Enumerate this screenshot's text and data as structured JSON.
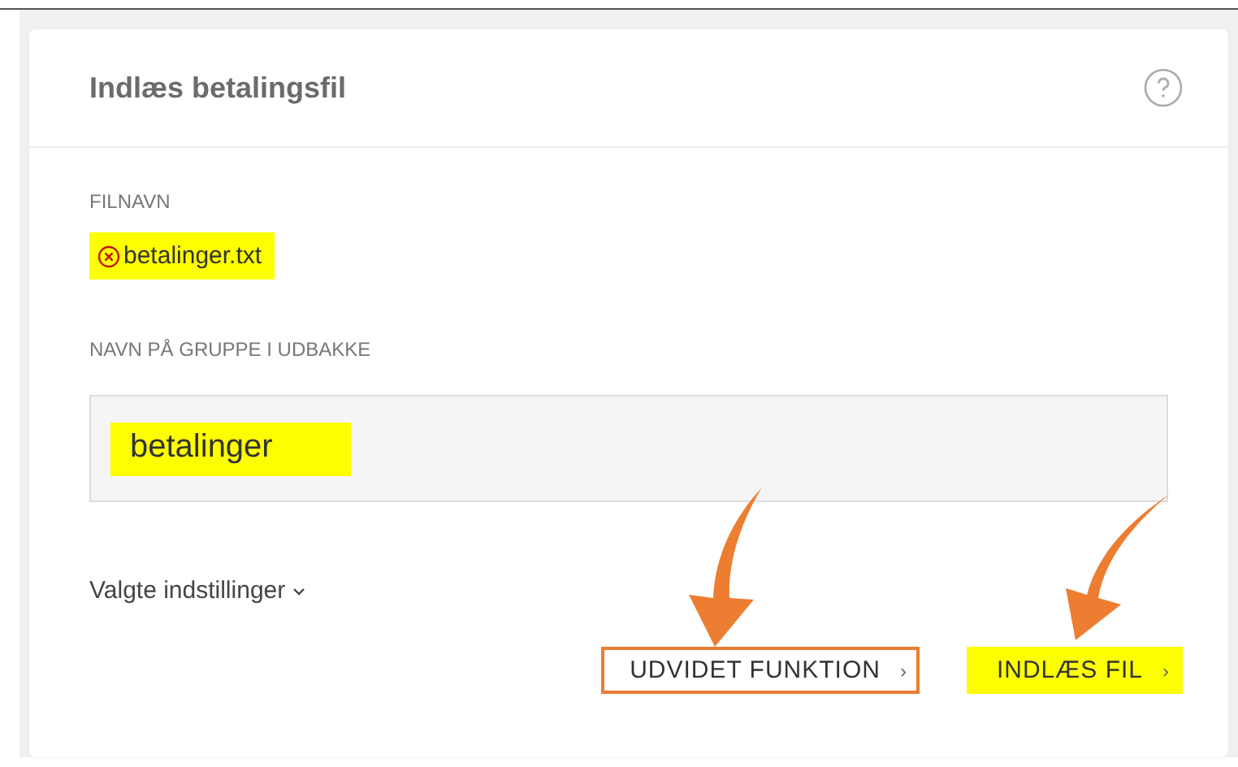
{
  "card": {
    "title": "Indlæs betalingsfil",
    "file": {
      "label": "FILNAVN",
      "name": "betalinger.txt",
      "error": true,
      "highlighted": true
    },
    "group": {
      "label": "NAVN PÅ GRUPPE I UDBAKKE",
      "value": "betalinger",
      "highlighted": true
    },
    "settings": {
      "label": "Valgte indstillinger",
      "expanded": false
    },
    "buttons": [
      {
        "label": "UDVIDET FUNKTION",
        "chevron": "›",
        "highlighted": false,
        "outlined": true
      },
      {
        "label": "INDLÆS FIL",
        "chevron": "›",
        "highlighted": true,
        "outlined": false
      }
    ]
  },
  "annotations": [
    {
      "kind": "arrow"
    },
    {
      "kind": "arrow"
    }
  ]
}
